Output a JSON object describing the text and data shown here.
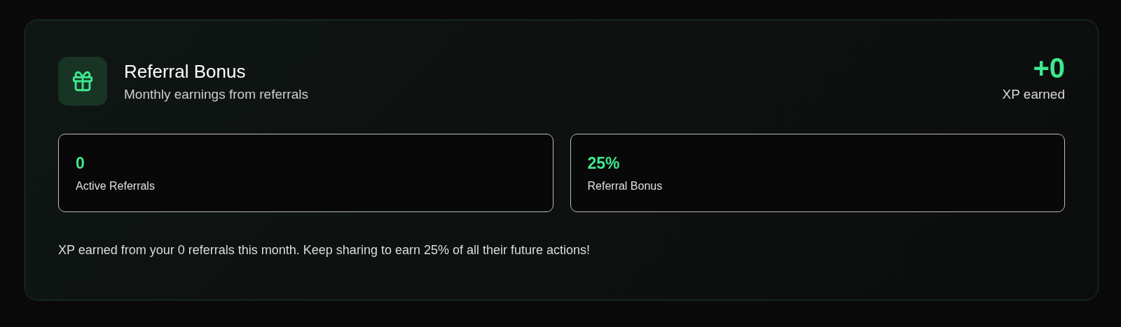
{
  "card": {
    "title": "Referral Bonus",
    "subtitle": "Monthly earnings from referrals",
    "xp_value": "+0",
    "xp_label": "XP earned",
    "stats": [
      {
        "value": "0",
        "label": "Active Referrals"
      },
      {
        "value": "25%",
        "label": "Referral Bonus"
      }
    ],
    "footer": "XP earned from your 0 referrals this month. Keep sharing to earn 25% of all their future actions!"
  }
}
